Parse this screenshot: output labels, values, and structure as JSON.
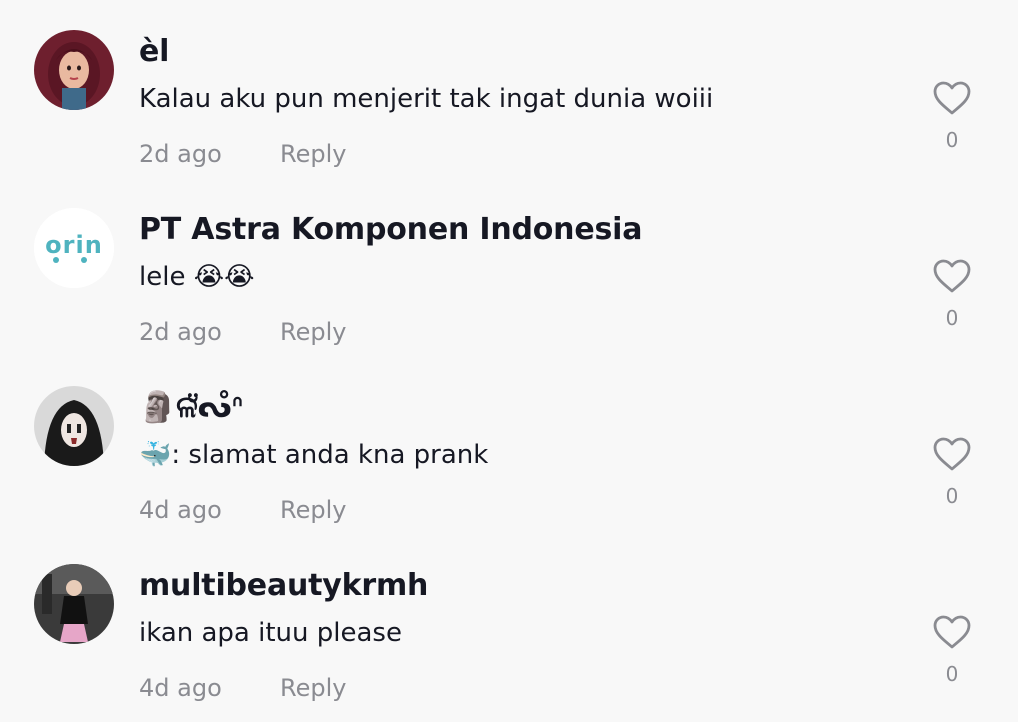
{
  "comments": [
    {
      "username": "èl",
      "text": "Kalau aku pun menjerit tak ingat dunia woiii",
      "time": "2d ago",
      "reply": "Reply",
      "likes": "0"
    },
    {
      "username": "PT Astra Komponen Indonesia",
      "text": "lele 😭😭",
      "time": "2d ago",
      "reply": "Reply",
      "likes": "0",
      "avatar_logo_text": "orin"
    },
    {
      "username": "🗿ଳ̆̈ᔓ̊ᐢ",
      "text": "🐳: slamat anda kna prank",
      "time": "4d ago",
      "reply": "Reply",
      "likes": "0"
    },
    {
      "username": "multibeautykrmh",
      "text": "ikan apa ituu please",
      "time": "4d ago",
      "reply": "Reply",
      "likes": "0"
    }
  ],
  "icons": {
    "like": "heart-outline-icon"
  },
  "colors": {
    "background": "#f8f8f8",
    "username": "#161823",
    "secondary": "#8a8b91"
  }
}
